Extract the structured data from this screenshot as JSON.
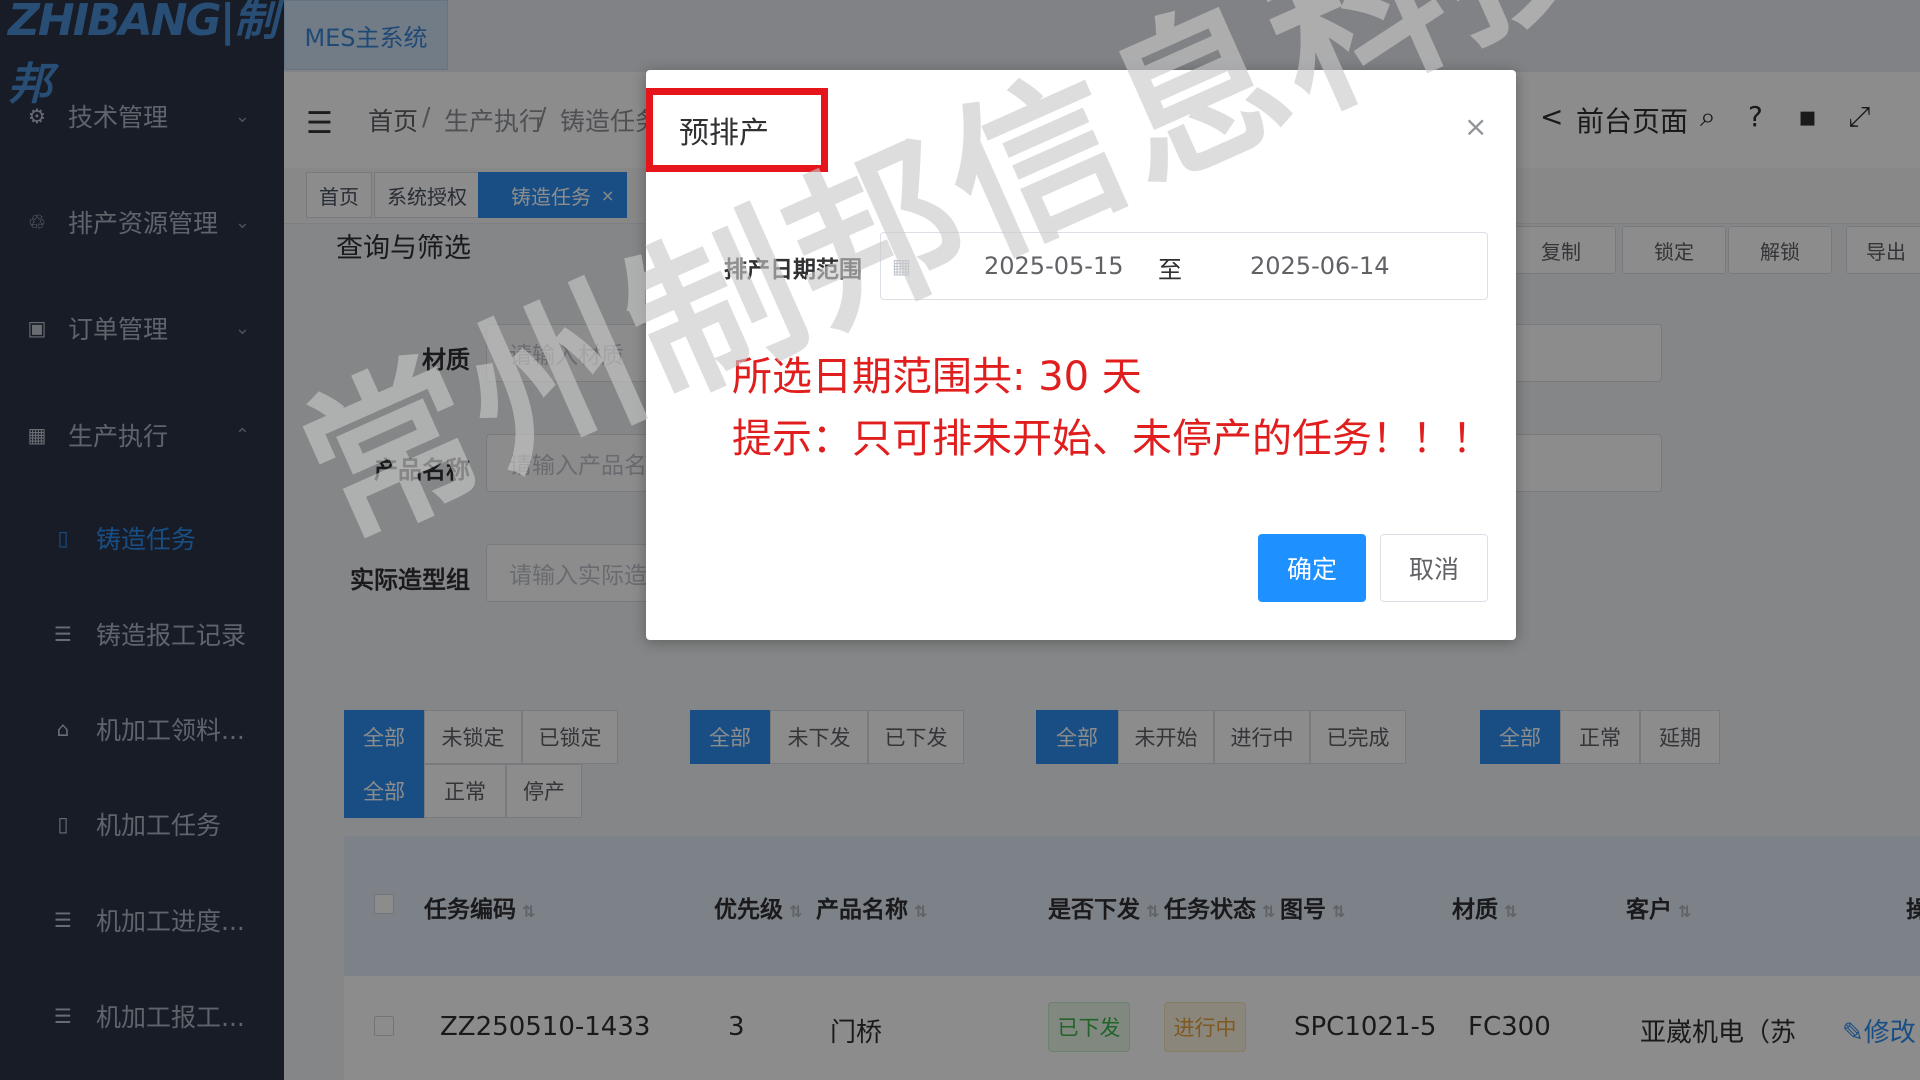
{
  "logo": "ZHIBANG|制邦",
  "system_tab": "MES主系统",
  "sidebar": {
    "menus": [
      {
        "label": "技术管理",
        "icon": "tech-icon"
      },
      {
        "label": "排产资源管理",
        "icon": "resource-icon"
      },
      {
        "label": "订单管理",
        "icon": "order-icon"
      },
      {
        "label": "生产执行",
        "icon": "calendar-icon"
      }
    ],
    "sub_items": [
      {
        "label": "铸造任务",
        "icon": "document-icon"
      },
      {
        "label": "铸造报工记录",
        "icon": "list-icon"
      },
      {
        "label": "机加工领料...",
        "icon": "home-icon"
      },
      {
        "label": "机加工任务",
        "icon": "document-icon"
      },
      {
        "label": "机加工进度...",
        "icon": "list-icon"
      },
      {
        "label": "机加工报工...",
        "icon": "list-icon"
      }
    ]
  },
  "breadcrumb": [
    "首页",
    "生产执行",
    "铸造任务"
  ],
  "breadcrumb_sep": "/",
  "header_right": {
    "front_page": "前台页面"
  },
  "tags": [
    "首页",
    "系统授权",
    "铸造任务"
  ],
  "tag_close": "×",
  "section_title": "查询与筛选",
  "filters": [
    {
      "label": "材质",
      "placeholder": "请输入材质"
    },
    {
      "label": "产品名称",
      "placeholder": "请输入产品名称"
    },
    {
      "label": "实际造型组",
      "placeholder": "请输入实际造型组"
    }
  ],
  "actions": [
    "复制",
    "锁定",
    "解锁",
    "导出"
  ],
  "segment_groups": [
    [
      "全部",
      "未锁定",
      "已锁定"
    ],
    [
      "全部",
      "未下发",
      "已下发"
    ],
    [
      "全部",
      "未开始",
      "进行中",
      "已完成"
    ],
    [
      "全部",
      "正常",
      "延期"
    ],
    [
      "全部",
      "正常",
      "停产"
    ]
  ],
  "table": {
    "headers": [
      "任务编码",
      "优先级",
      "产品名称",
      "是否下发",
      "任务状态",
      "图号",
      "材质",
      "客户",
      "操"
    ],
    "rows": [
      {
        "code": "ZZ250510-1433",
        "priority": "3",
        "product": "门桥",
        "issued": "已下发",
        "status": "进行中",
        "drawing": "SPC1021-5",
        "material": "FC300",
        "customer": "亚崴机电（苏",
        "action": "修改"
      }
    ]
  },
  "colors": {
    "primary": "#2f8ff0",
    "sidebar": "#2b3445",
    "warning_text": "#e01e1e",
    "highlight_box": "#e6151b"
  },
  "dialog": {
    "title": "预排产",
    "close": "×",
    "field_label": "排产日期范围",
    "start_date": "2025-05-15",
    "range_sep": "至",
    "end_date": "2025-06-14",
    "days_text": "所选日期范围共: 30 天",
    "tip_text": "提示：只可排未开始、未停产的任务！！！",
    "ok": "确定",
    "cancel": "取消"
  },
  "watermark": "常州制邦信息科技"
}
